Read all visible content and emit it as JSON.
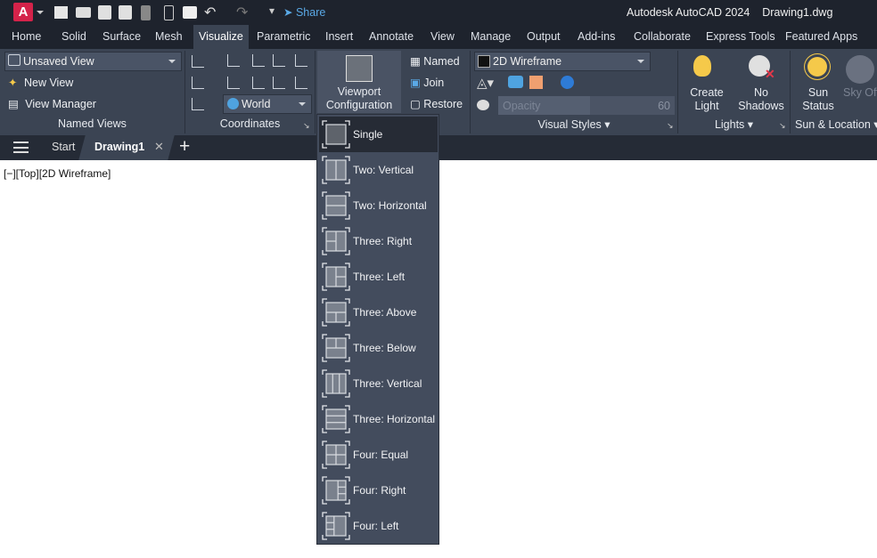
{
  "title": {
    "app": "Autodesk AutoCAD 2024",
    "file": "Drawing1.dwg",
    "share": "Share",
    "logo": "A"
  },
  "ribbon_tabs": [
    "Home",
    "Solid",
    "Surface",
    "Mesh",
    "Visualize",
    "Parametric",
    "Insert",
    "Annotate",
    "View",
    "Manage",
    "Output",
    "Add-ins",
    "Collaborate",
    "Express Tools",
    "Featured Apps"
  ],
  "active_tab": "Visualize",
  "named_views": {
    "combo": "Unsaved View",
    "new_view": "New View",
    "view_manager": "View Manager",
    "title": "Named Views"
  },
  "coordinates": {
    "ucs_combo": "World",
    "title": "Coordinates"
  },
  "model_viewports": {
    "config_line1": "Viewport",
    "config_line2": "Configuration",
    "named": "Named",
    "join": "Join",
    "restore": "Restore"
  },
  "visual_styles": {
    "combo": "2D Wireframe",
    "opacity_placeholder": "Opacity",
    "opacity_value": "60",
    "title": "Visual Styles"
  },
  "lights": {
    "create_1": "Create",
    "create_2": "Light",
    "shadows_1": "No",
    "shadows_2": "Shadows",
    "title": "Lights"
  },
  "sun": {
    "status_1": "Sun",
    "status_2": "Status",
    "sky": "Sky Off",
    "title": "Sun & Location"
  },
  "doc_tabs": {
    "start": "Start",
    "drawing": "Drawing1"
  },
  "viewport_label": "[−][Top][2D Wireframe]",
  "viewport_menu": [
    {
      "label": "Single",
      "icon": "single",
      "selected": true
    },
    {
      "label": "Two: Vertical",
      "icon": "two-v"
    },
    {
      "label": "Two: Horizontal",
      "icon": "two-h"
    },
    {
      "label": "Three: Right",
      "icon": "three-r"
    },
    {
      "label": "Three: Left",
      "icon": "three-l"
    },
    {
      "label": "Three: Above",
      "icon": "three-a"
    },
    {
      "label": "Three: Below",
      "icon": "three-b"
    },
    {
      "label": "Three: Vertical",
      "icon": "three-v"
    },
    {
      "label": "Three: Horizontal",
      "icon": "three-h"
    },
    {
      "label": "Four: Equal",
      "icon": "four-e"
    },
    {
      "label": "Four: Right",
      "icon": "four-r"
    },
    {
      "label": "Four: Left",
      "icon": "four-l"
    }
  ],
  "colors": {
    "brand": "#d4234a",
    "ribbon": "#3b4453",
    "menu": "#434c5d"
  }
}
